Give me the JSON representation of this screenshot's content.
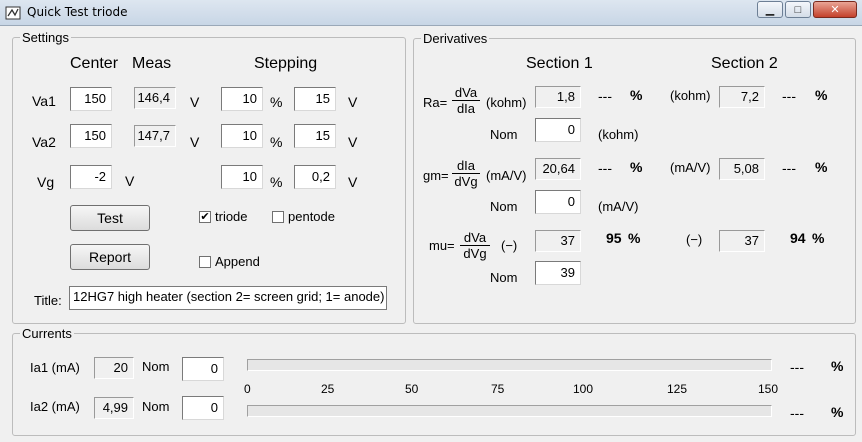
{
  "window": {
    "title": "Quick Test triode",
    "minimize_label": "▁",
    "maximize_label": "□",
    "close_label": "✕"
  },
  "settings": {
    "legend": "Settings",
    "col_center": "Center",
    "col_meas": "Meas",
    "col_stepping": "Stepping",
    "rows": [
      {
        "label": "Va1",
        "center": "150",
        "meas": "146,4",
        "unit": "V",
        "step_pct": "10",
        "pct": "%",
        "step_val": "15",
        "step_unit": "V"
      },
      {
        "label": "Va2",
        "center": "150",
        "meas": "147,7",
        "unit": "V",
        "step_pct": "10",
        "pct": "%",
        "step_val": "15",
        "step_unit": "V"
      },
      {
        "label": "Vg",
        "center": "-2",
        "unit": "V",
        "step_pct": "10",
        "pct": "%",
        "step_val": "0,2",
        "step_unit": "V"
      }
    ],
    "test_label": "Test",
    "report_label": "Report",
    "triode_label": "triode",
    "triode_checked": "✔",
    "pentode_label": "pentode",
    "append_label": "Append",
    "title_label": "Title:",
    "title_value": "12HG7 high heater (section 2= screen grid; 1= anode)"
  },
  "derivatives": {
    "legend": "Derivatives",
    "section1": "Section 1",
    "section2": "Section 2",
    "ra": {
      "label": "Ra=",
      "num": "dVa",
      "den": "dIa",
      "unit": "(kohm)",
      "s1": "1,8",
      "s1_pct": "---",
      "s2_unit": "(kohm)",
      "s2": "7,2",
      "s2_pct": "---",
      "pct": "%",
      "nom_label": "Nom",
      "nom": "0",
      "nom_unit": "(kohm)"
    },
    "gm": {
      "label": "gm=",
      "num": "dIa",
      "den": "dVg",
      "unit": "(mA/V)",
      "s1": "20,64",
      "s1_pct": "---",
      "s2_unit": "(mA/V)",
      "s2": "5,08",
      "s2_pct": "---",
      "pct": "%",
      "nom_label": "Nom",
      "nom": "0",
      "nom_unit": "(mA/V)"
    },
    "mu": {
      "label": "mu=",
      "num": "dVa",
      "den": "dVg",
      "unit": "(−)",
      "s1": "37",
      "s1_pct": "95",
      "s2_unit": "(−)",
      "s2": "37",
      "s2_pct": "94",
      "pct": "%",
      "nom_label": "Nom",
      "nom": "39"
    }
  },
  "currents": {
    "legend": "Currents",
    "ia1": {
      "label": "Ia1 (mA)",
      "value": "20",
      "nom_label": "Nom",
      "nom": "0",
      "pct_val": "---",
      "pct": "%",
      "fill_fraction": 0.0
    },
    "ia2": {
      "label": "Ia2 (mA)",
      "value": "4,99",
      "nom_label": "Nom",
      "nom": "0",
      "pct_val": "---",
      "pct": "%",
      "fill_fraction": 0.0
    },
    "scale": [
      "0",
      "25",
      "50",
      "75",
      "100",
      "125",
      "150"
    ]
  },
  "colors": {
    "bar_fill": "#2fbd3a"
  }
}
